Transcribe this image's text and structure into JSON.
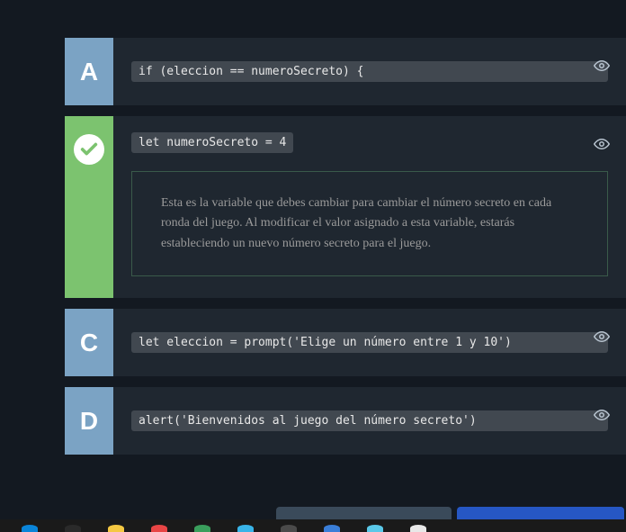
{
  "options": [
    {
      "letter": "A",
      "code": "if (eleccion == numeroSecreto) {",
      "correct": false
    },
    {
      "letter": "check",
      "code": "let numeroSecreto = 4",
      "correct": true,
      "explanation": "Esta es la variable que debes cambiar para cambiar el número secreto en cada ronda del juego. Al modificar el valor asignado a esta variable, estarás estableciendo un nuevo número secreto para el juego."
    },
    {
      "letter": "C",
      "code": "let eleccion = prompt('Elige un número entre 1 y 10')",
      "correct": false
    },
    {
      "letter": "D",
      "code": "alert('Bienvenidos al juego del número secreto')",
      "correct": false
    }
  ],
  "taskbar_colors": [
    "#0a84d8",
    "#2a2a2a",
    "#f5c842",
    "#e84545",
    "#3a9e5c",
    "#39b4e8",
    "#4a4a4a",
    "#3a7ed8",
    "#5ac8e8",
    "#e8e8e8"
  ]
}
